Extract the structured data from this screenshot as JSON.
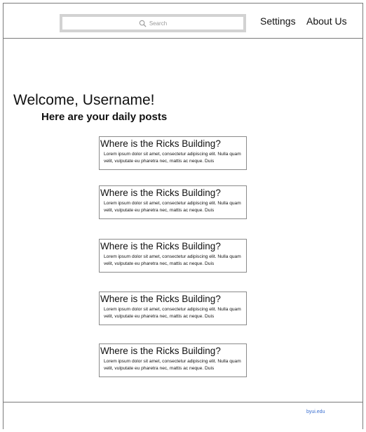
{
  "header": {
    "search_placeholder": "Search",
    "nav": {
      "settings": "Settings",
      "about": "About Us"
    }
  },
  "main": {
    "welcome": "Welcome, Username!",
    "subtitle": "Here are your daily posts",
    "posts": [
      {
        "title": "Where is the Ricks Building?",
        "body": "Lorem ipsum dolor sit amet, consectetur adipiscing elit. Nulla quam velit, vulputate eu pharetra nec, mattis ac neque. Duis"
      },
      {
        "title": "Where is the Ricks Building?",
        "body": "Lorem ipsum dolor sit amet, consectetur adipiscing elit. Nulla quam velit, vulputate eu pharetra nec, mattis ac neque. Duis"
      },
      {
        "title": "Where is the Ricks Building?",
        "body": "Lorem ipsum dolor sit amet, consectetur adipiscing elit. Nulla quam velit, vulputate eu pharetra nec, mattis ac neque. Duis"
      },
      {
        "title": "Where is the Ricks Building?",
        "body": "Lorem ipsum dolor sit amet, consectetur adipiscing elit. Nulla quam velit, vulputate eu pharetra nec, mattis ac neque. Duis"
      },
      {
        "title": "Where is the Ricks Building?",
        "body": "Lorem ipsum dolor sit amet, consectetur adipiscing elit. Nulla quam velit, vulputate eu pharetra nec, mattis ac neque. Duis"
      }
    ]
  },
  "footer": {
    "link": "byui.edu"
  },
  "colors": {
    "border": "#7a7a7a",
    "search_border": "#d2d2d2",
    "link": "#3a6fd0"
  },
  "icons": {
    "search": "search-icon"
  }
}
